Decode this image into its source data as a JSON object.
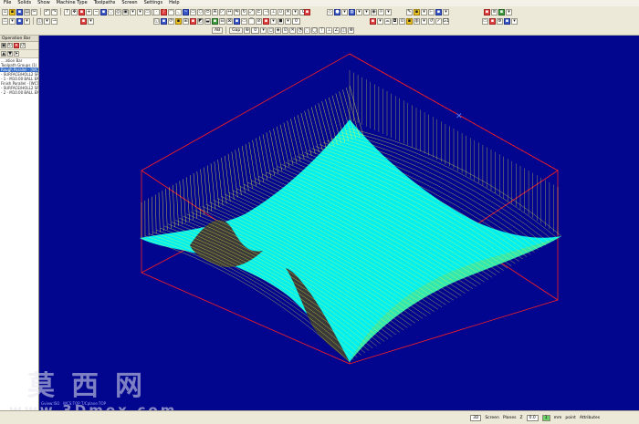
{
  "menubar": {
    "items": [
      "File",
      "Solids",
      "Show",
      "Machine Type",
      "Toolpaths",
      "Screen",
      "Settings",
      "Help"
    ]
  },
  "toolbar": {
    "top_select": "0",
    "row2_select": "0",
    "row3_left_btn": "AB",
    "row3_left_btn2": "Gap",
    "row3_select": "0"
  },
  "sidebar": {
    "title": "Operation Bar",
    "tree": [
      "... ation Bar",
      "",
      "Toolpath Groups (1) ...",
      "",
      "Rough Parallel - [WCS: TOP]",
      "- SURFACE/HOLL2 SPHERE",
      "- 1 - M10.00 BALL ENDMILL - Prog...",
      "",
      "Finish Parallel - [WCS: TOP]",
      "- SURFACE/HOLL2 SPHERE",
      "- 2 - M10.00 BALL ENDMILL - Prog..."
    ]
  },
  "viewport": {
    "background": "#02058e",
    "box_color": "#ff2020",
    "toolpath_yellow": "#ffff40",
    "surface_cyan": "#00ffff",
    "labels": {
      "gview": "Gview:ISO",
      "wcs": "WCS:TOP",
      "tplane": "T/Cplane:TOP"
    }
  },
  "statusbar": {
    "item1": "3D",
    "item2": "Screen",
    "planes_label": "Planes",
    "z_label": "Z",
    "z_value": "0.0",
    "level_value": "1",
    "attributes": "Attributes",
    "units": "mm",
    "point_label": "point"
  },
  "watermark": {
    "cn": "莫西网",
    "url": "www.3Dmox.com"
  }
}
